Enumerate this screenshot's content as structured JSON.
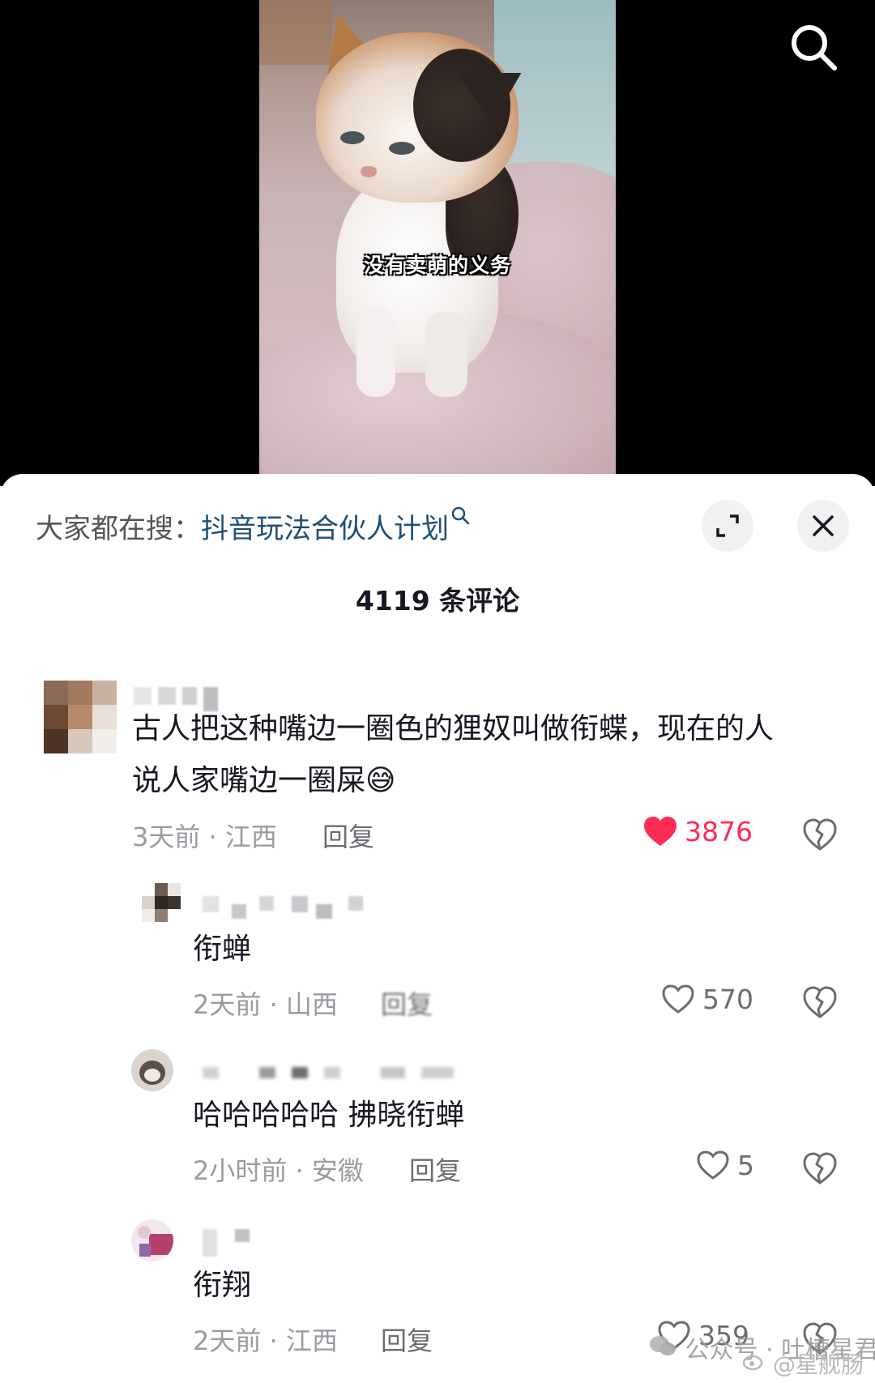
{
  "video": {
    "subtitle": "没有卖萌的义务"
  },
  "panel": {
    "trending_prefix": "大家都在搜：",
    "trending_keyword": "抖音玩法合伙人计划",
    "comment_count": "4119 条评论"
  },
  "comments": [
    {
      "text_line1": "古人把这种嘴边一圈色的狸奴叫做衔蝶，现在的人",
      "text_line2": "说人家嘴边一圈屎",
      "emoji": "😅",
      "meta": "3天前 · 江西",
      "reply": "回复",
      "likes": "3876",
      "liked": true
    },
    {
      "text": "衔蝉",
      "meta": "2天前 · 山西",
      "reply": "回复",
      "likes": "570",
      "liked": false
    },
    {
      "text": "哈哈哈哈哈 拂晓衔蝉",
      "meta": "2小时前 · 安徽",
      "reply": "回复",
      "likes": "5",
      "liked": false
    },
    {
      "text": "衔翔",
      "meta": "2天前 · 江西",
      "reply": "回复",
      "likes": "359",
      "liked": false
    }
  ],
  "watermark": {
    "wechat": "公众号 · 吐槽星君",
    "weibo": "@星舰肠"
  },
  "colors": {
    "like_red": "#fe2c55",
    "keyword_blue": "#1f4f77",
    "meta_gray": "#9a9ba1"
  },
  "icons": [
    "search-icon",
    "expand-icon",
    "close-icon",
    "heart-icon",
    "heart-filled-icon",
    "broken-heart-icon",
    "wechat-icon",
    "weibo-icon"
  ]
}
